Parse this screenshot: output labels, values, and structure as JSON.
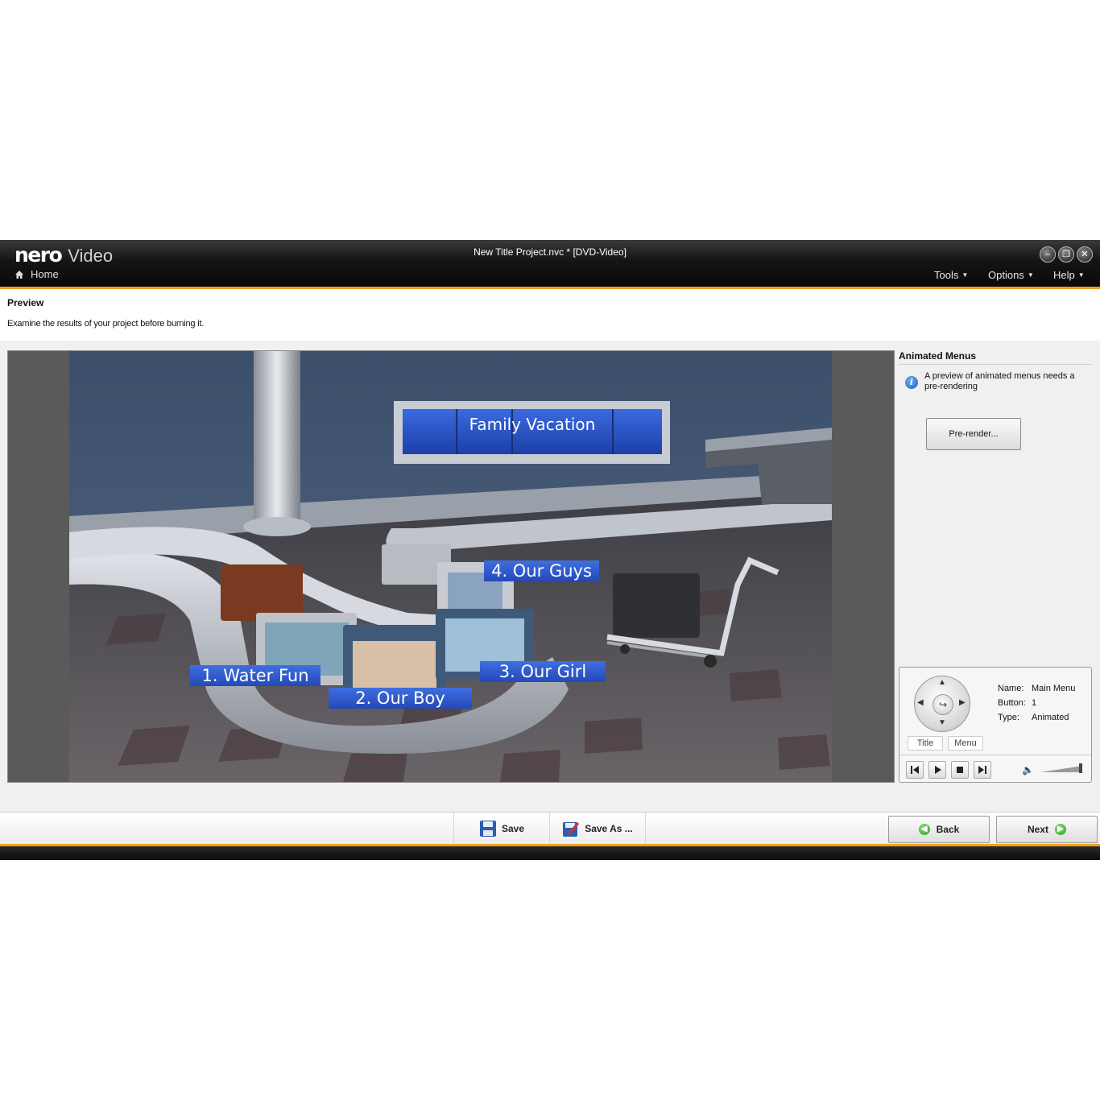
{
  "app": {
    "brand_nero": "nero",
    "brand_video": "Video",
    "window_title": "New Title Project.nvc * [DVD-Video]"
  },
  "nav": {
    "home": "Home",
    "menus": [
      "Tools",
      "Options",
      "Help"
    ]
  },
  "page": {
    "title": "Preview",
    "description": "Examine the results of your project before burning it."
  },
  "scene": {
    "banner": "Family Vacation",
    "buttons": [
      "1. Water Fun",
      "2. Our Boy",
      "3. Our Girl",
      "4. Our Guys"
    ]
  },
  "side": {
    "title": "Animated Menus",
    "info": "A preview of animated menus needs a pre-rendering",
    "prerender": "Pre-render..."
  },
  "remote": {
    "tabs": [
      "Title",
      "Menu"
    ],
    "name_label": "Name:",
    "name_value": "Main Menu",
    "button_label": "Button:",
    "button_value": "1",
    "type_label": "Type:",
    "type_value": "Animated"
  },
  "toolbar": {
    "save": "Save",
    "save_as": "Save As ...",
    "back": "Back",
    "next": "Next"
  },
  "colors": {
    "accent": "#f0a020",
    "title_bg": "#141414",
    "label_blue": "#2f5bd0"
  }
}
